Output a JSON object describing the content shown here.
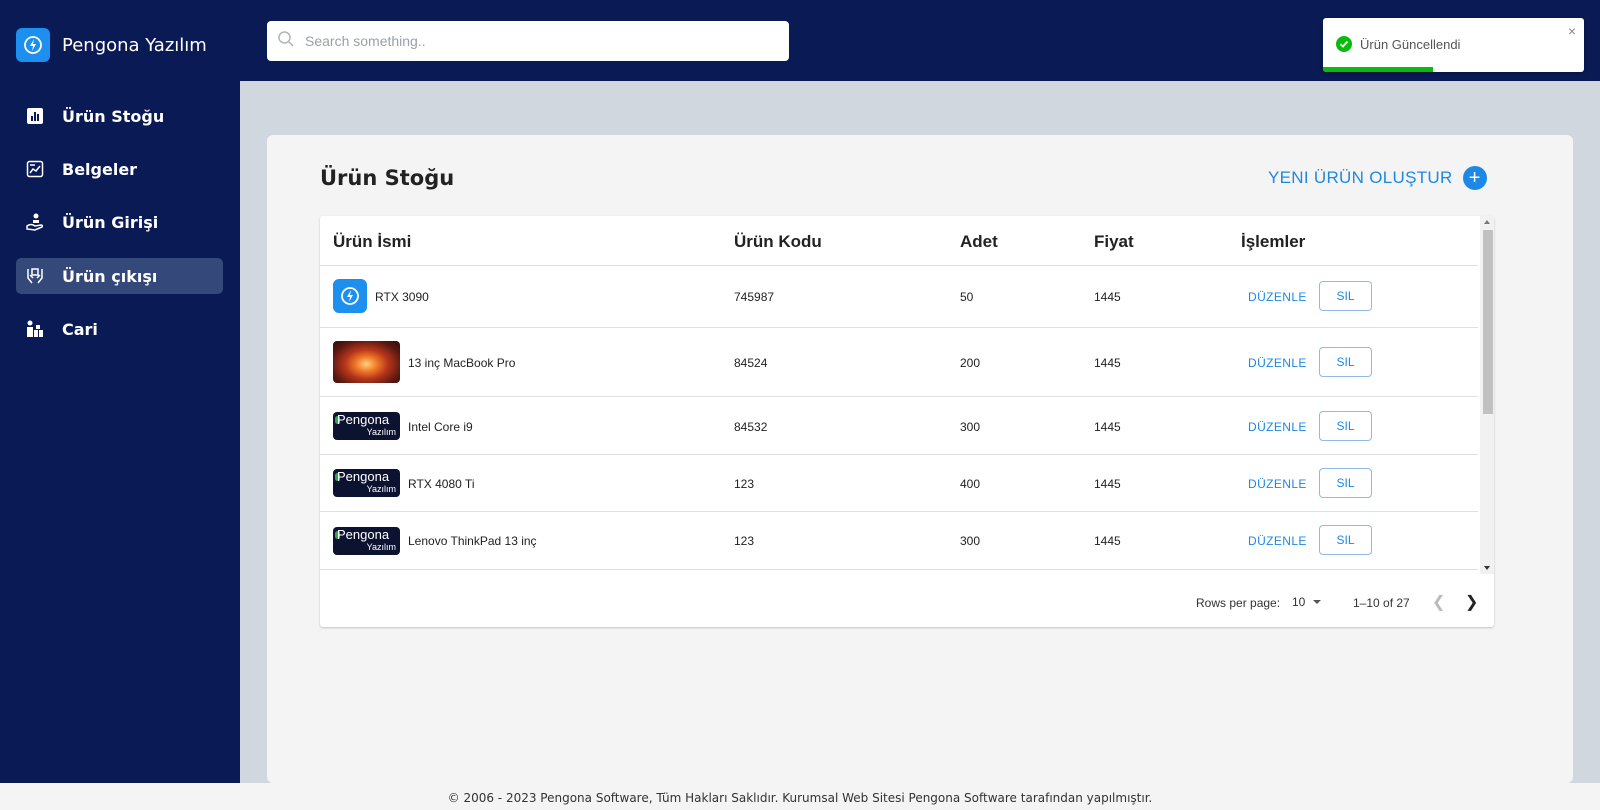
{
  "brand": {
    "name": "Pengona Yazılım"
  },
  "sidebar": {
    "items": [
      {
        "label": "Ürün Stoğu",
        "icon": "bar-chart-icon"
      },
      {
        "label": "Belgeler",
        "icon": "document-chart-icon"
      },
      {
        "label": "Ürün Girişi",
        "icon": "hand-receive-icon"
      },
      {
        "label": "Ürün çıkışı",
        "icon": "hands-give-icon",
        "active": true
      },
      {
        "label": "Cari",
        "icon": "boxes-person-icon"
      }
    ]
  },
  "search": {
    "placeholder": "Search something.."
  },
  "toast": {
    "message": "Ürün Güncellendi",
    "close": "×",
    "progress": 0.42,
    "status_color": "#07bc0c"
  },
  "main": {
    "title": "Ürün Stoğu",
    "new_button": "YENI ÜRÜN OLUŞTUR",
    "columns": [
      "Ürün İsmi",
      "Ürün Kodu",
      "Adet",
      "Fiyat",
      "İşlemler"
    ],
    "rows": [
      {
        "name": "RTX 3090",
        "code": "745987",
        "qty": "50",
        "price": "1445",
        "edit": "DÜZENLE",
        "delete": "SIL",
        "thumb": "brand-icon"
      },
      {
        "name": "13 inç MacBook Pro",
        "code": "84524",
        "qty": "200",
        "price": "1445",
        "edit": "DÜZENLE",
        "delete": "SIL",
        "thumb": "photo"
      },
      {
        "name": "Intel Core i9",
        "code": "84532",
        "qty": "300",
        "price": "1445",
        "edit": "DÜZENLE",
        "delete": "SIL",
        "thumb": "logo"
      },
      {
        "name": "RTX 4080 Ti",
        "code": "123",
        "qty": "400",
        "price": "1445",
        "edit": "DÜZENLE",
        "delete": "SIL",
        "thumb": "logo"
      },
      {
        "name": "Lenovo ThinkPad 13 inç",
        "code": "123",
        "qty": "300",
        "price": "1445",
        "edit": "DÜZENLE",
        "delete": "SIL",
        "thumb": "logo"
      }
    ],
    "logo_text": {
      "top": "Pengona",
      "bottom": "Yazılım"
    },
    "pagination": {
      "rows_per_page_label": "Rows per page:",
      "rows_per_page": "10",
      "range": "1–10 of 27"
    }
  },
  "footer": {
    "text": "© 2006 - 2023 Pengona Software, Tüm Hakları Saklıdır. Kurumsal Web Sitesi Pengona Software tarafından yapılmıştır."
  },
  "colors": {
    "sidebar": "#0a1a55",
    "accent": "#1e88e5",
    "active_item": "#34487a"
  }
}
